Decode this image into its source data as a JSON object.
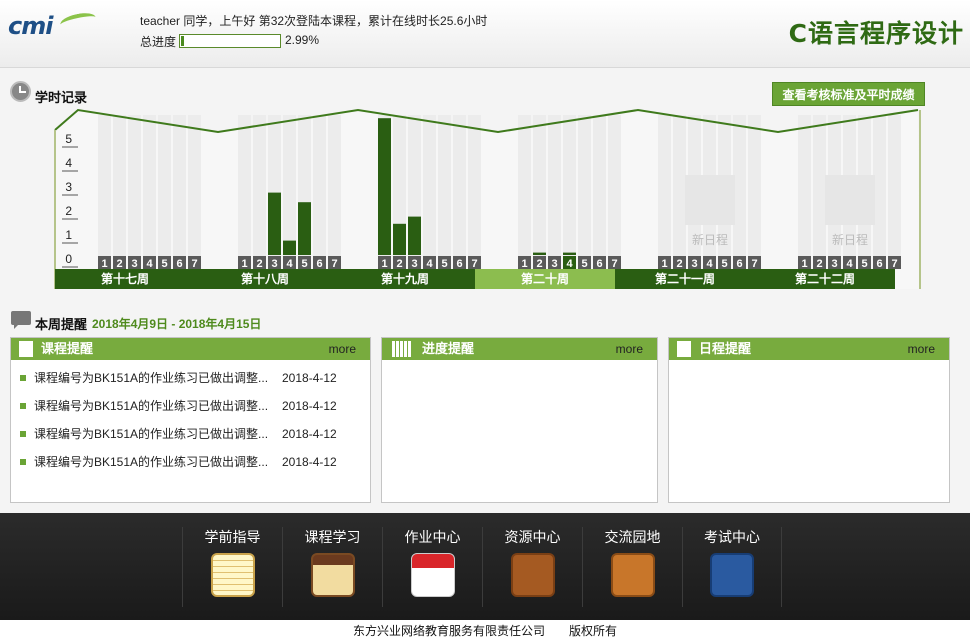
{
  "header": {
    "greeting": "teacher 同学，上午好 第32次登陆本课程，累计在线时长25.6小时",
    "progress_label": "总进度",
    "progress_value": "2.99%",
    "progress_fraction": 0.0299,
    "course_title": "C语言程序设计",
    "logo_text": "cmi"
  },
  "study_record": {
    "title": "学时记录",
    "view_button": "查看考核标准及平时成绩",
    "y_ticks": [
      "5",
      "4",
      "3",
      "2",
      "1",
      "0"
    ],
    "weeks": [
      {
        "label": "第十七周",
        "bars": [
          0,
          0,
          0,
          0,
          0,
          0,
          0
        ],
        "current": false,
        "new_schedule": false
      },
      {
        "label": "第十八周",
        "bars": [
          0,
          0,
          2.6,
          0.6,
          2.2,
          0,
          0
        ],
        "current": false,
        "new_schedule": false
      },
      {
        "label": "第十九周",
        "bars": [
          5.7,
          1.3,
          1.6,
          0,
          0,
          0,
          0
        ],
        "current": false,
        "new_schedule": false
      },
      {
        "label": "第二十周",
        "bars": [
          0,
          0.1,
          0,
          0.1,
          0,
          0,
          0
        ],
        "current": true,
        "highlight_day": 4,
        "new_schedule": false
      },
      {
        "label": "第二十一周",
        "bars": [
          0,
          0,
          0,
          0,
          0,
          0,
          0
        ],
        "current": false,
        "new_schedule": true
      },
      {
        "label": "第二十二周",
        "bars": [
          0,
          0,
          0,
          0,
          0,
          0,
          0
        ],
        "current": false,
        "new_schedule": true
      }
    ],
    "day_labels": [
      "1",
      "2",
      "3",
      "4",
      "5",
      "6",
      "7"
    ],
    "new_schedule_label": "新日程"
  },
  "reminders": {
    "title": "本周提醒",
    "range": "2018年4月9日 - 2018年4月15日",
    "more_label": "more",
    "course": {
      "title": "课程提醒",
      "items": [
        {
          "text": "课程编号为BK151A的作业练习已做出调整...",
          "date": "2018-4-12"
        },
        {
          "text": "课程编号为BK151A的作业练习已做出调整...",
          "date": "2018-4-12"
        },
        {
          "text": "课程编号为BK151A的作业练习已做出调整...",
          "date": "2018-4-12"
        },
        {
          "text": "课程编号为BK151A的作业练习已做出调整...",
          "date": "2018-4-12"
        }
      ]
    },
    "progress": {
      "title": "进度提醒"
    },
    "schedule": {
      "title": "日程提醒"
    }
  },
  "nav": [
    {
      "label": "学前指导",
      "icon": "notepad-icon"
    },
    {
      "label": "课程学习",
      "icon": "notebook-icon"
    },
    {
      "label": "作业中心",
      "icon": "calendar-icon"
    },
    {
      "label": "资源中心",
      "icon": "download-icon"
    },
    {
      "label": "交流园地",
      "icon": "chat-icon"
    },
    {
      "label": "考试中心",
      "icon": "exam-book-icon"
    }
  ],
  "footer": "东方兴业网络教育服务有限责任公司　　版权所有",
  "colors": {
    "accent_green": "#78ab3e",
    "dark_green": "#2f6a14",
    "week_bar": "#2a5e12",
    "current_week": "#8cbd4f"
  }
}
